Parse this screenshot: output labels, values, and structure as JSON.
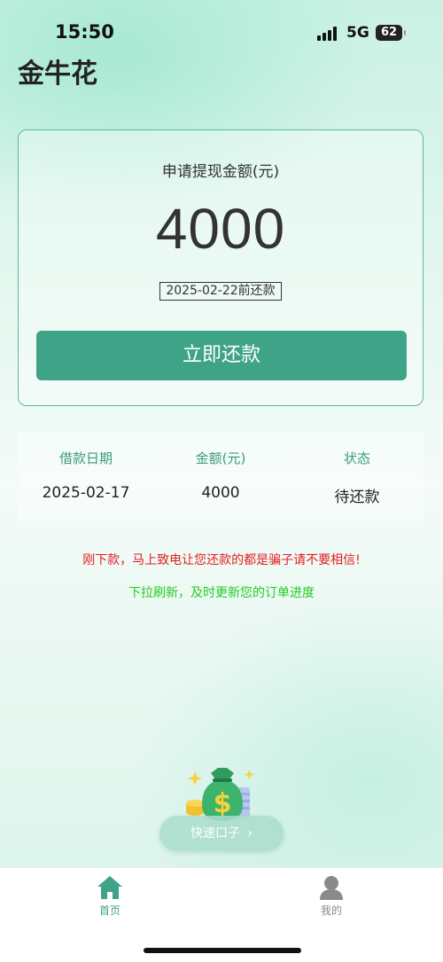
{
  "status_bar": {
    "time": "15:50",
    "network": "5G",
    "battery": "62"
  },
  "app": {
    "title": "金牛花"
  },
  "amount_card": {
    "label": "申请提现金额(元)",
    "amount": "4000",
    "due_text": "2025-02-22前还款",
    "repay_button": "立即还款"
  },
  "loan_table": {
    "headers": [
      "借款日期",
      "金额(元)",
      "状态"
    ],
    "row": [
      "2025-02-17",
      "4000",
      "待还款"
    ]
  },
  "notices": {
    "warning": "刚下款，马上致电让您还款的都是骗子请不要相信!",
    "refresh": "下拉刷新，及时更新您的订单进度"
  },
  "quick": {
    "label": "快速口子",
    "icon": "money-bag-icon"
  },
  "tab_bar": {
    "items": [
      {
        "label": "首页",
        "icon": "home-icon",
        "active": true
      },
      {
        "label": "我的",
        "icon": "user-icon",
        "active": false
      }
    ]
  },
  "colors": {
    "accent": "#3fa487",
    "warning": "#e02020",
    "refresh": "#22cc22",
    "inactive": "#8a8a8a"
  }
}
